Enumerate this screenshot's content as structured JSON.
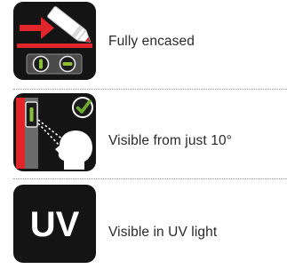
{
  "features": [
    {
      "label": "Fully encased",
      "icon": "encased-seal-icon"
    },
    {
      "label": "Visible from just 10°",
      "icon": "viewer-check-icon"
    },
    {
      "label": "Visible in UV light",
      "icon": "uv-icon",
      "icon_text": "UV"
    }
  ],
  "colors": {
    "tile_background": "#141414",
    "accent_red": "#e0262b",
    "accent_green": "#6cae2c",
    "text": "#2a2a2a",
    "divider": "#9a9a9a"
  }
}
